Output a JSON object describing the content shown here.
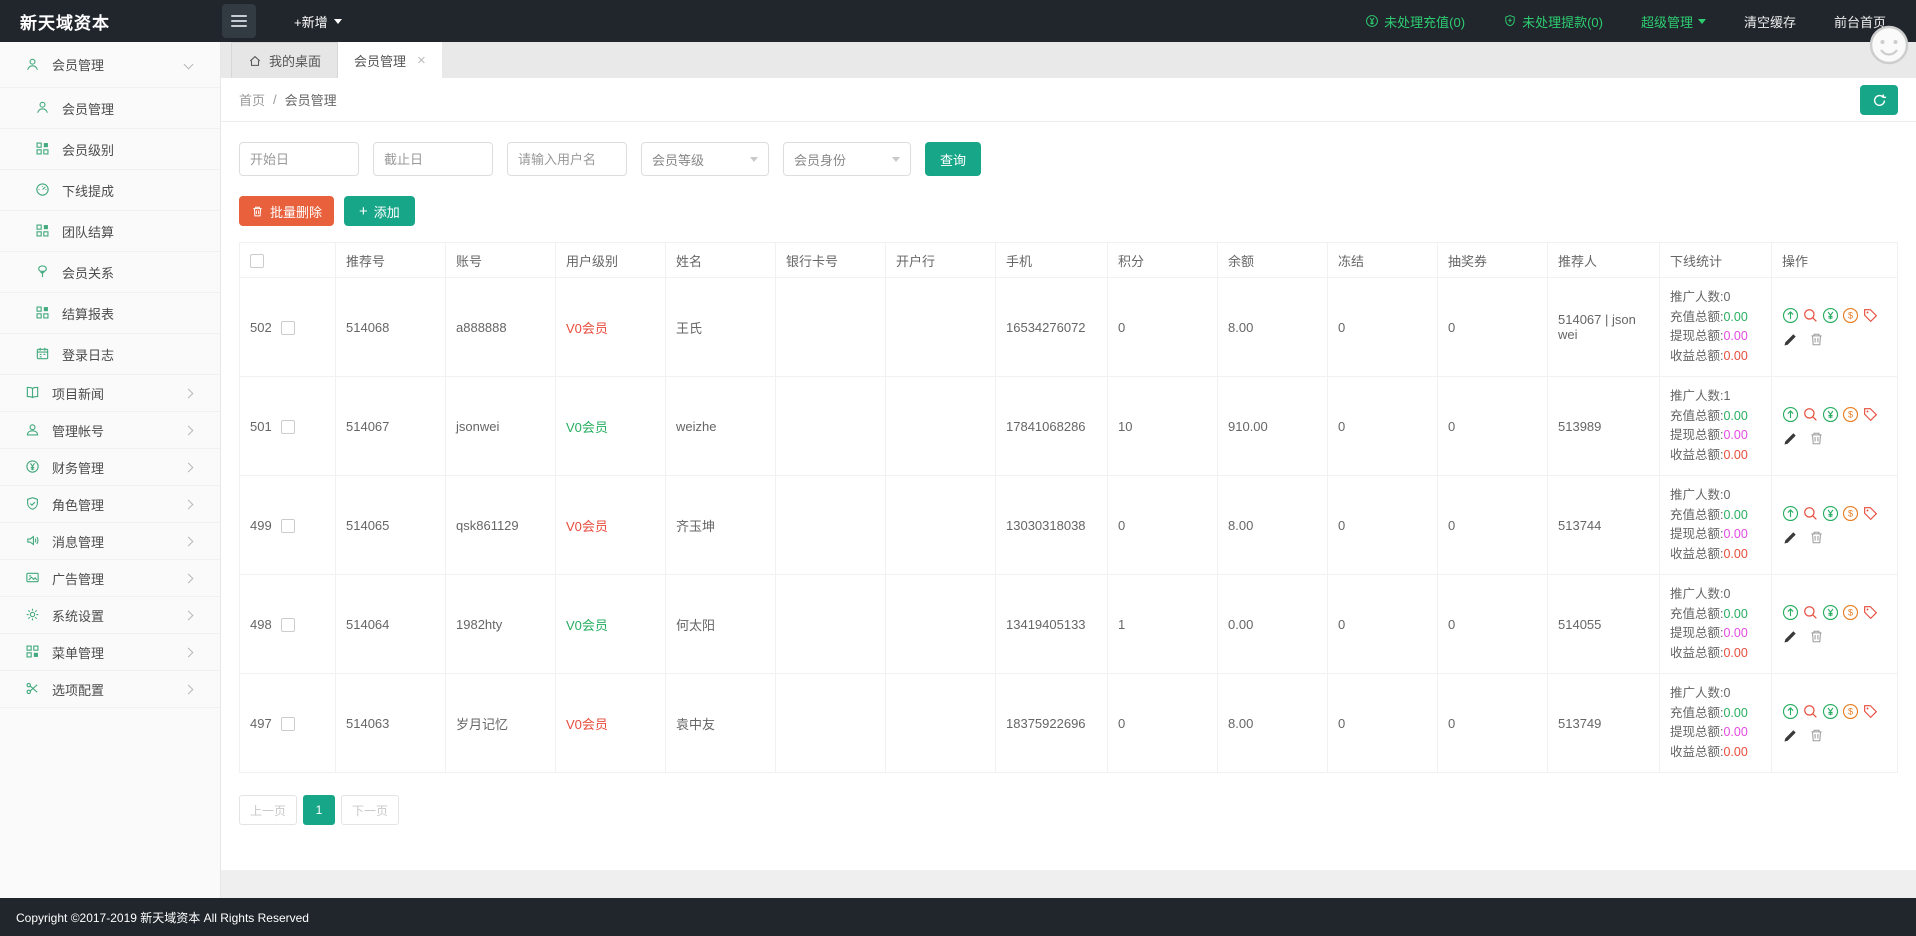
{
  "topbar": {
    "logo": "新天域资本",
    "new_button": "+新增",
    "pending_recharge": "未处理充值(0)",
    "pending_withdraw": "未处理提款(0)",
    "admin_menu": "超级管理",
    "clear_cache": "清空缓存",
    "front_home": "前台首页"
  },
  "tabs": {
    "desktop": "我的桌面",
    "member": "会员管理"
  },
  "breadcrumb": {
    "home": "首页",
    "separator": "/",
    "current": "会员管理"
  },
  "filters": {
    "start_date_placeholder": "开始日",
    "end_date_placeholder": "截止日",
    "username_placeholder": "请输入用户名",
    "level_select": "会员等级",
    "identity_select": "会员身份",
    "search_button": "查询"
  },
  "actions": {
    "batch_delete": "批量删除",
    "add": "添加"
  },
  "table": {
    "headers": [
      "推荐号",
      "账号",
      "用户级别",
      "姓名",
      "银行卡号",
      "开户行",
      "手机",
      "积分",
      "余额",
      "冻结",
      "抽奖券",
      "推荐人",
      "下线统计",
      "操作"
    ],
    "rows": [
      {
        "id": "502",
        "ref": "514068",
        "account": "a888888",
        "level": "V0会员",
        "level_color": "red",
        "name": "王氏",
        "bank_card": "",
        "bank": "",
        "phone": "16534276072",
        "points": "0",
        "balance": "8.00",
        "frozen": "0",
        "tickets": "0",
        "referrer": "514067 | json wei",
        "promo_count": "0",
        "recharge_total": "0.00",
        "withdraw_total": "0.00",
        "income_total": "0.00"
      },
      {
        "id": "501",
        "ref": "514067",
        "account": "jsonwei",
        "level": "V0会员",
        "level_color": "green",
        "name": "weizhe",
        "bank_card": "",
        "bank": "",
        "phone": "17841068286",
        "points": "10",
        "balance": "910.00",
        "frozen": "0",
        "tickets": "0",
        "referrer": "513989",
        "promo_count": "1",
        "recharge_total": "0.00",
        "withdraw_total": "0.00",
        "income_total": "0.00"
      },
      {
        "id": "499",
        "ref": "514065",
        "account": "qsk861129",
        "level": "V0会员",
        "level_color": "red",
        "name": "齐玉坤",
        "bank_card": "",
        "bank": "",
        "phone": "13030318038",
        "points": "0",
        "balance": "8.00",
        "frozen": "0",
        "tickets": "0",
        "referrer": "513744",
        "promo_count": "0",
        "recharge_total": "0.00",
        "withdraw_total": "0.00",
        "income_total": "0.00"
      },
      {
        "id": "498",
        "ref": "514064",
        "account": "1982hty",
        "level": "V0会员",
        "level_color": "green",
        "name": "何太阳",
        "bank_card": "",
        "bank": "",
        "phone": "13419405133",
        "points": "1",
        "balance": "0.00",
        "frozen": "0",
        "tickets": "0",
        "referrer": "514055",
        "promo_count": "0",
        "recharge_total": "0.00",
        "withdraw_total": "0.00",
        "income_total": "0.00"
      },
      {
        "id": "497",
        "ref": "514063",
        "account": "岁月记忆",
        "level": "V0会员",
        "level_color": "red",
        "name": "袁中友",
        "bank_card": "",
        "bank": "",
        "phone": "18375922696",
        "points": "0",
        "balance": "8.00",
        "frozen": "0",
        "tickets": "0",
        "referrer": "513749",
        "promo_count": "0",
        "recharge_total": "0.00",
        "withdraw_total": "0.00",
        "income_total": "0.00"
      }
    ]
  },
  "stats_labels": {
    "promo": "推广人数:",
    "recharge": "充值总额:",
    "withdraw": "提现总额:",
    "income": "收益总额:"
  },
  "pagination": {
    "prev": "上一页",
    "current": "1",
    "next": "下一页"
  },
  "footer": {
    "copyright": "Copyright ©2017-2019 新天域资本 All Rights Reserved"
  },
  "sidebar": {
    "items": [
      {
        "label": "会员管理",
        "icon": "user",
        "type": "parent-open",
        "chevron": "down"
      },
      {
        "label": "会员管理",
        "icon": "user",
        "type": "child"
      },
      {
        "label": "会员级别",
        "icon": "grid",
        "type": "child"
      },
      {
        "label": "下线提成",
        "icon": "gauge",
        "type": "child"
      },
      {
        "label": "团队结算",
        "icon": "grid",
        "type": "child"
      },
      {
        "label": "会员关系",
        "icon": "tree",
        "type": "child"
      },
      {
        "label": "结算报表",
        "icon": "grid",
        "type": "child"
      },
      {
        "label": "登录日志",
        "icon": "calendar",
        "type": "child"
      },
      {
        "label": "项目新闻",
        "icon": "book",
        "type": "parent",
        "chevron": "right"
      },
      {
        "label": "管理帐号",
        "icon": "user2",
        "type": "parent",
        "chevron": "right"
      },
      {
        "label": "财务管理",
        "icon": "yen",
        "type": "parent",
        "chevron": "right"
      },
      {
        "label": "角色管理",
        "icon": "shield",
        "type": "parent",
        "chevron": "right"
      },
      {
        "label": "消息管理",
        "icon": "speaker",
        "type": "parent",
        "chevron": "right"
      },
      {
        "label": "广告管理",
        "icon": "image",
        "type": "parent",
        "chevron": "right"
      },
      {
        "label": "系统设置",
        "icon": "gear",
        "type": "parent",
        "chevron": "right"
      },
      {
        "label": "菜单管理",
        "icon": "menu-grid",
        "type": "parent",
        "chevron": "right"
      },
      {
        "label": "选项配置",
        "icon": "scissors",
        "type": "parent",
        "chevron": "right"
      }
    ]
  },
  "colors": {
    "accent": "#18a689",
    "delete": "#e8603c",
    "red": "#e74c3c",
    "green": "#27ae60",
    "magenta": "#e24ae2",
    "topbar_green": "#2ecc71"
  }
}
